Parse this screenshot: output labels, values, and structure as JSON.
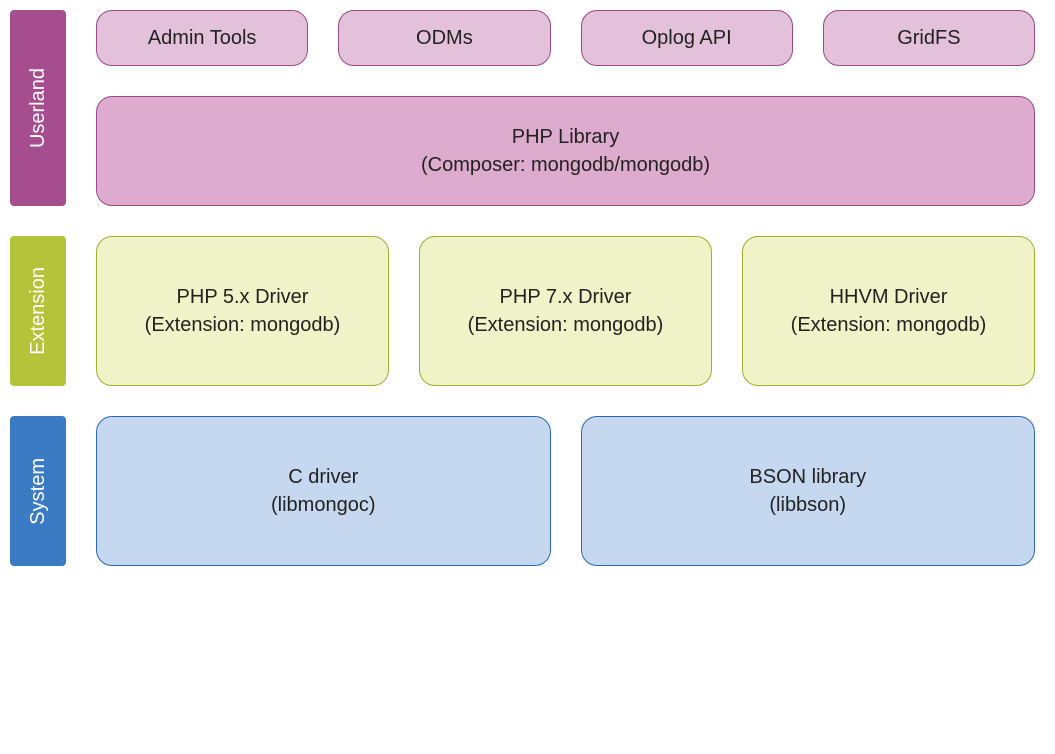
{
  "layers": {
    "userland": {
      "label": "Userland",
      "tools": [
        {
          "label": "Admin Tools"
        },
        {
          "label": "ODMs"
        },
        {
          "label": "Oplog API"
        },
        {
          "label": "GridFS"
        }
      ],
      "library": {
        "title": "PHP Library",
        "subtitle": "(Composer: mongodb/mongodb)"
      }
    },
    "extension": {
      "label": "Extension",
      "drivers": [
        {
          "title": "PHP 5.x Driver",
          "subtitle": "(Extension: mongodb)"
        },
        {
          "title": "PHP 7.x Driver",
          "subtitle": "(Extension: mongodb)"
        },
        {
          "title": "HHVM Driver",
          "subtitle": "(Extension: mongodb)"
        }
      ]
    },
    "system": {
      "label": "System",
      "libs": [
        {
          "title": "C driver",
          "subtitle": "(libmongoc)"
        },
        {
          "title": "BSON library",
          "subtitle": "(libbson)"
        }
      ]
    }
  },
  "colors": {
    "userland_label": "#a64d90",
    "userland_box_light": "#e4c1da",
    "userland_box": "#ddabce",
    "extension_label": "#b4c43a",
    "extension_box": "#f0f2c8",
    "system_label": "#3a7bc4",
    "system_box": "#c5d8ef"
  }
}
